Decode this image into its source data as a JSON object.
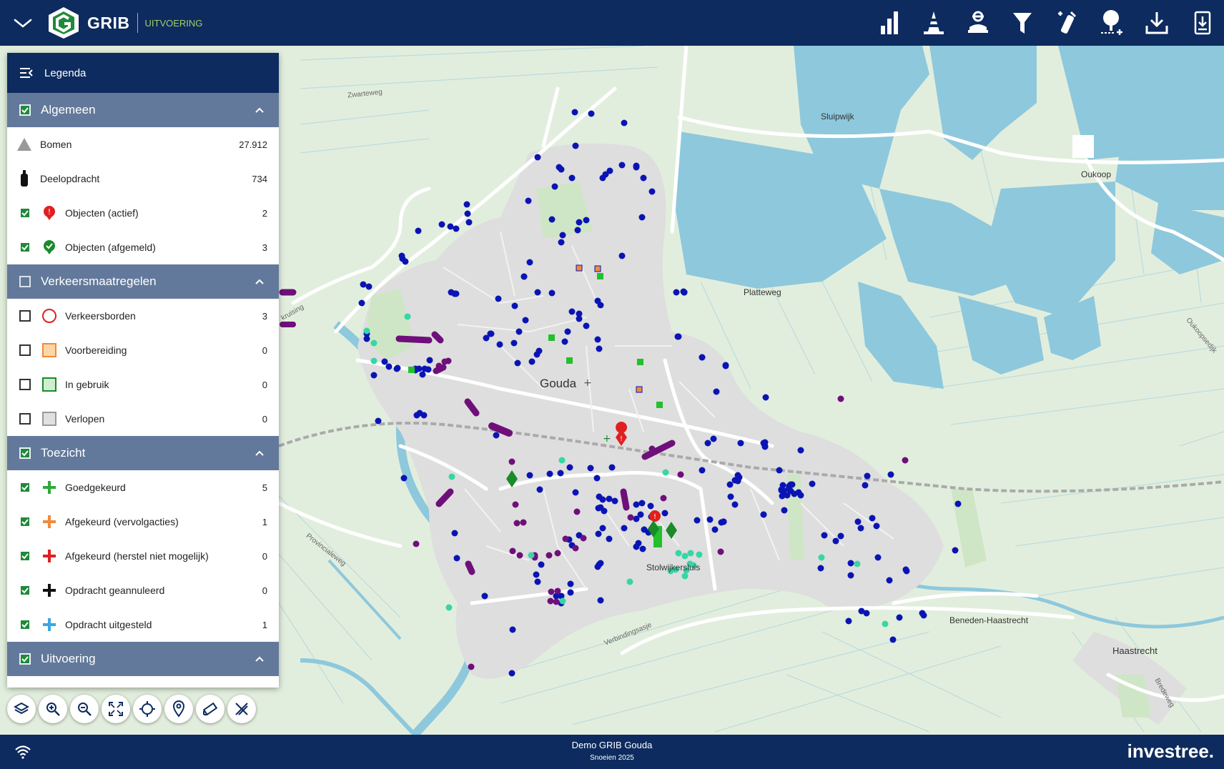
{
  "header": {
    "brand": "GRIB",
    "module": "UITVOERING"
  },
  "toolbar": {
    "icons": [
      "bar-chart-icon",
      "traffic-cone-icon",
      "worker-icon",
      "filter-icon",
      "tree-pruning-icon",
      "tree-select-icon",
      "download-icon",
      "export-icon"
    ]
  },
  "legend": {
    "title": "Legenda",
    "sections": {
      "algemeen": {
        "label": "Algemeen",
        "checked": true
      },
      "verkeer": {
        "label": "Verkeersmaatregelen",
        "checked": false
      },
      "toezicht": {
        "label": "Toezicht",
        "checked": true
      },
      "uitvoering": {
        "label": "Uitvoering",
        "checked": true
      }
    },
    "rows": {
      "bomen": {
        "label": "Bomen",
        "count": "27.912"
      },
      "deelopdracht": {
        "label": "Deelopdracht",
        "count": "734"
      },
      "objecten_actief": {
        "label": "Objecten (actief)",
        "count": "2"
      },
      "objecten_afgemeld": {
        "label": "Objecten (afgemeld)",
        "count": "3"
      },
      "verkeersborden": {
        "label": "Verkeersborden",
        "count": "3"
      },
      "voorbereiding": {
        "label": "Voorbereiding",
        "count": "0"
      },
      "in_gebruik": {
        "label": "In gebruik",
        "count": "0"
      },
      "verlopen": {
        "label": "Verlopen",
        "count": "0"
      },
      "goedgekeurd": {
        "label": "Goedgekeurd",
        "count": "5"
      },
      "afgekeurd_vervolg": {
        "label": "Afgekeurd (vervolgacties)",
        "count": "1"
      },
      "afgekeurd_herstel": {
        "label": "Afgekeurd (herstel niet mogelijk)",
        "count": "0"
      },
      "geannuleerd": {
        "label": "Opdracht geannuleerd",
        "count": "0"
      },
      "uitgesteld": {
        "label": "Opdracht uitgesteld",
        "count": "1"
      }
    }
  },
  "map": {
    "places": {
      "gouda": "Gouda",
      "sluipwijk": "Sluipwijk",
      "oukoop": "Oukoop",
      "platteweg": "Platteweg",
      "stolwijkersluis": "Stolwijkersluis",
      "beneden": "Beneden-Haastrecht",
      "haastrecht": "Haastrecht",
      "zwarteweg": "Zwarteweg",
      "provincialeweg": "Provincialeweg",
      "verbindingsasje": "Verbindingsasje",
      "oukoopsedijk": "Oukoopsedijk",
      "bredeweg": "Bredeweg",
      "kruising": "kruising"
    },
    "colors": {
      "tree": "#0a14b4",
      "pruned": "#6e0f7a",
      "ok": "#36d6a6",
      "active": "#e02020",
      "done": "#1a8a2a",
      "water": "#8ec8dc",
      "urban": "#dedede"
    }
  },
  "controls": [
    "layers-icon",
    "zoom-in-icon",
    "zoom-out-icon",
    "fullscreen-icon",
    "locate-icon",
    "pin-icon",
    "measure-icon",
    "draw-icon"
  ],
  "footer": {
    "title": "Demo GRIB Gouda",
    "subtitle": "Snoeien 2025",
    "brand": "investree."
  }
}
